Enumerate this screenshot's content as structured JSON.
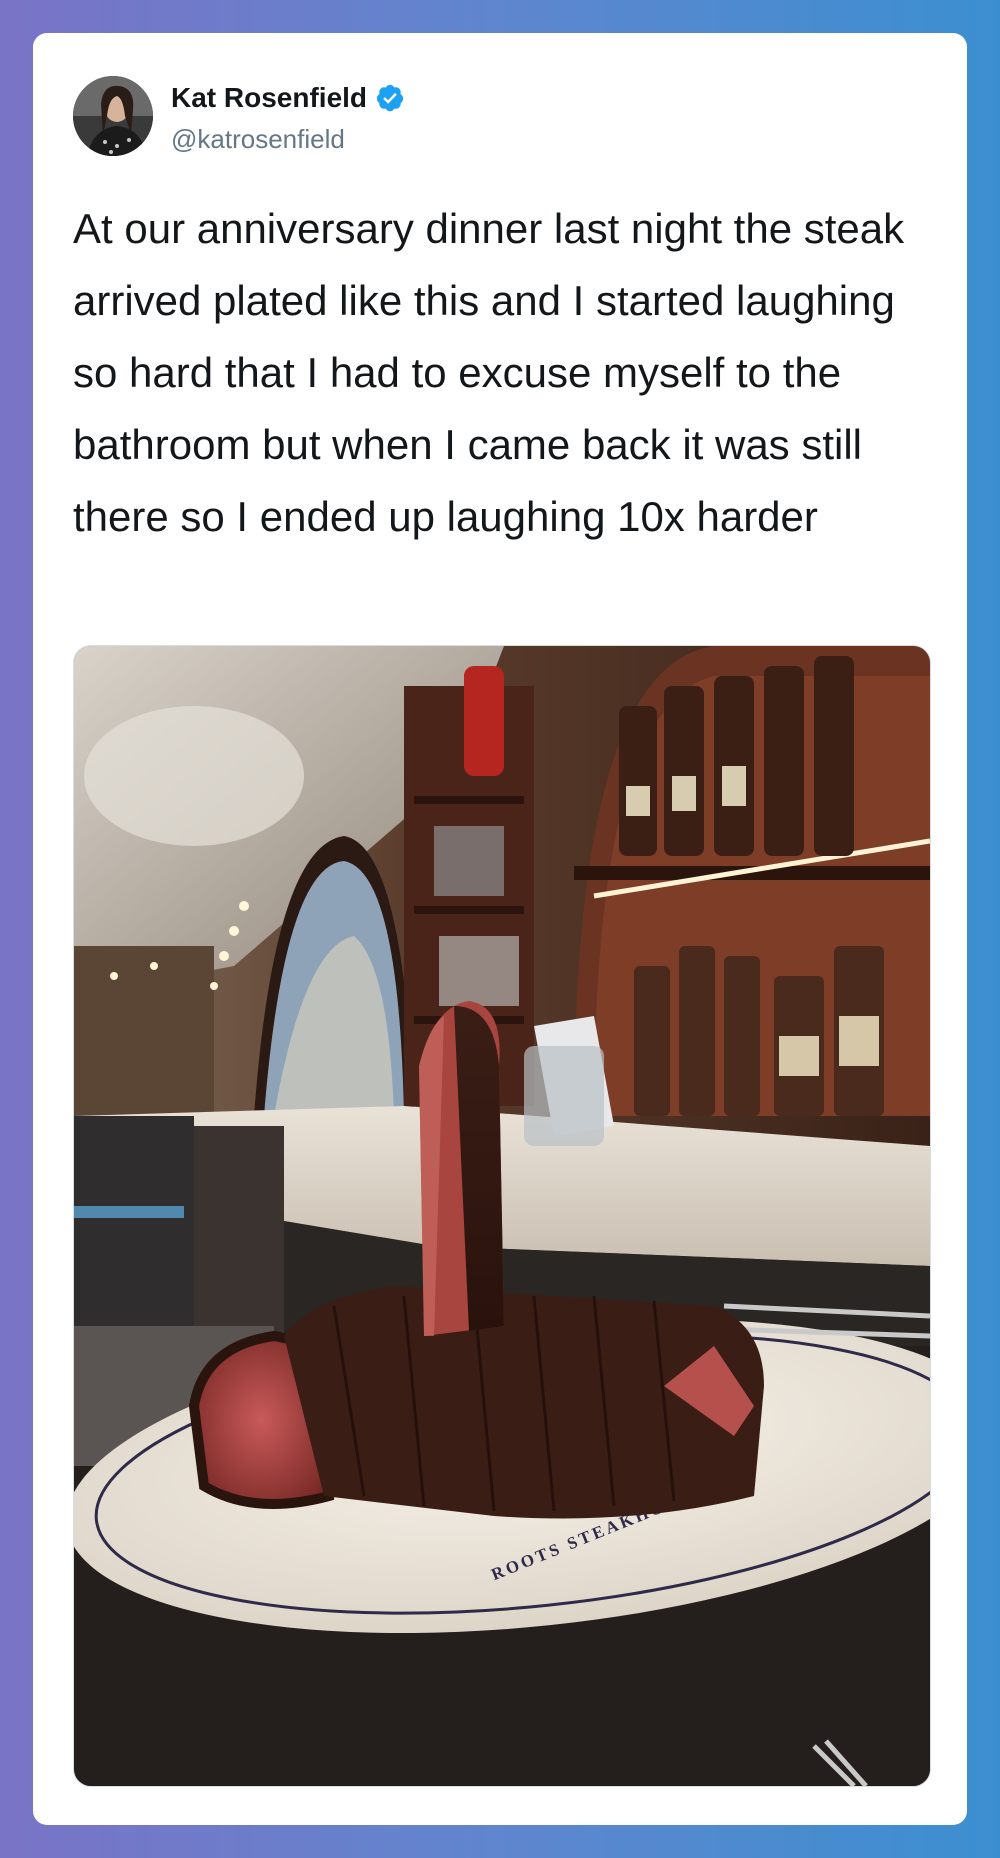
{
  "tweet": {
    "author": {
      "display_name": "Kat Rosenfield",
      "handle": "@katrosenfield",
      "verified": true
    },
    "text": "At our anniversary dinner last night the steak arrived plated like this and I started laughing so hard that I had to excuse myself to the bathroom but when I came back it was still there so I ended up laughing 10x harder",
    "media": {
      "plate_inscription": "ROOTS STEAKHOUSE"
    }
  },
  "colors": {
    "background_left": "#7a73c6",
    "background_right": "#3b8fd0",
    "verified_badge": "#1da1f2",
    "text_primary": "#14171a",
    "text_secondary": "#657786"
  },
  "icons": {
    "verified": "verified-badge-icon",
    "avatar": "profile-photo"
  }
}
